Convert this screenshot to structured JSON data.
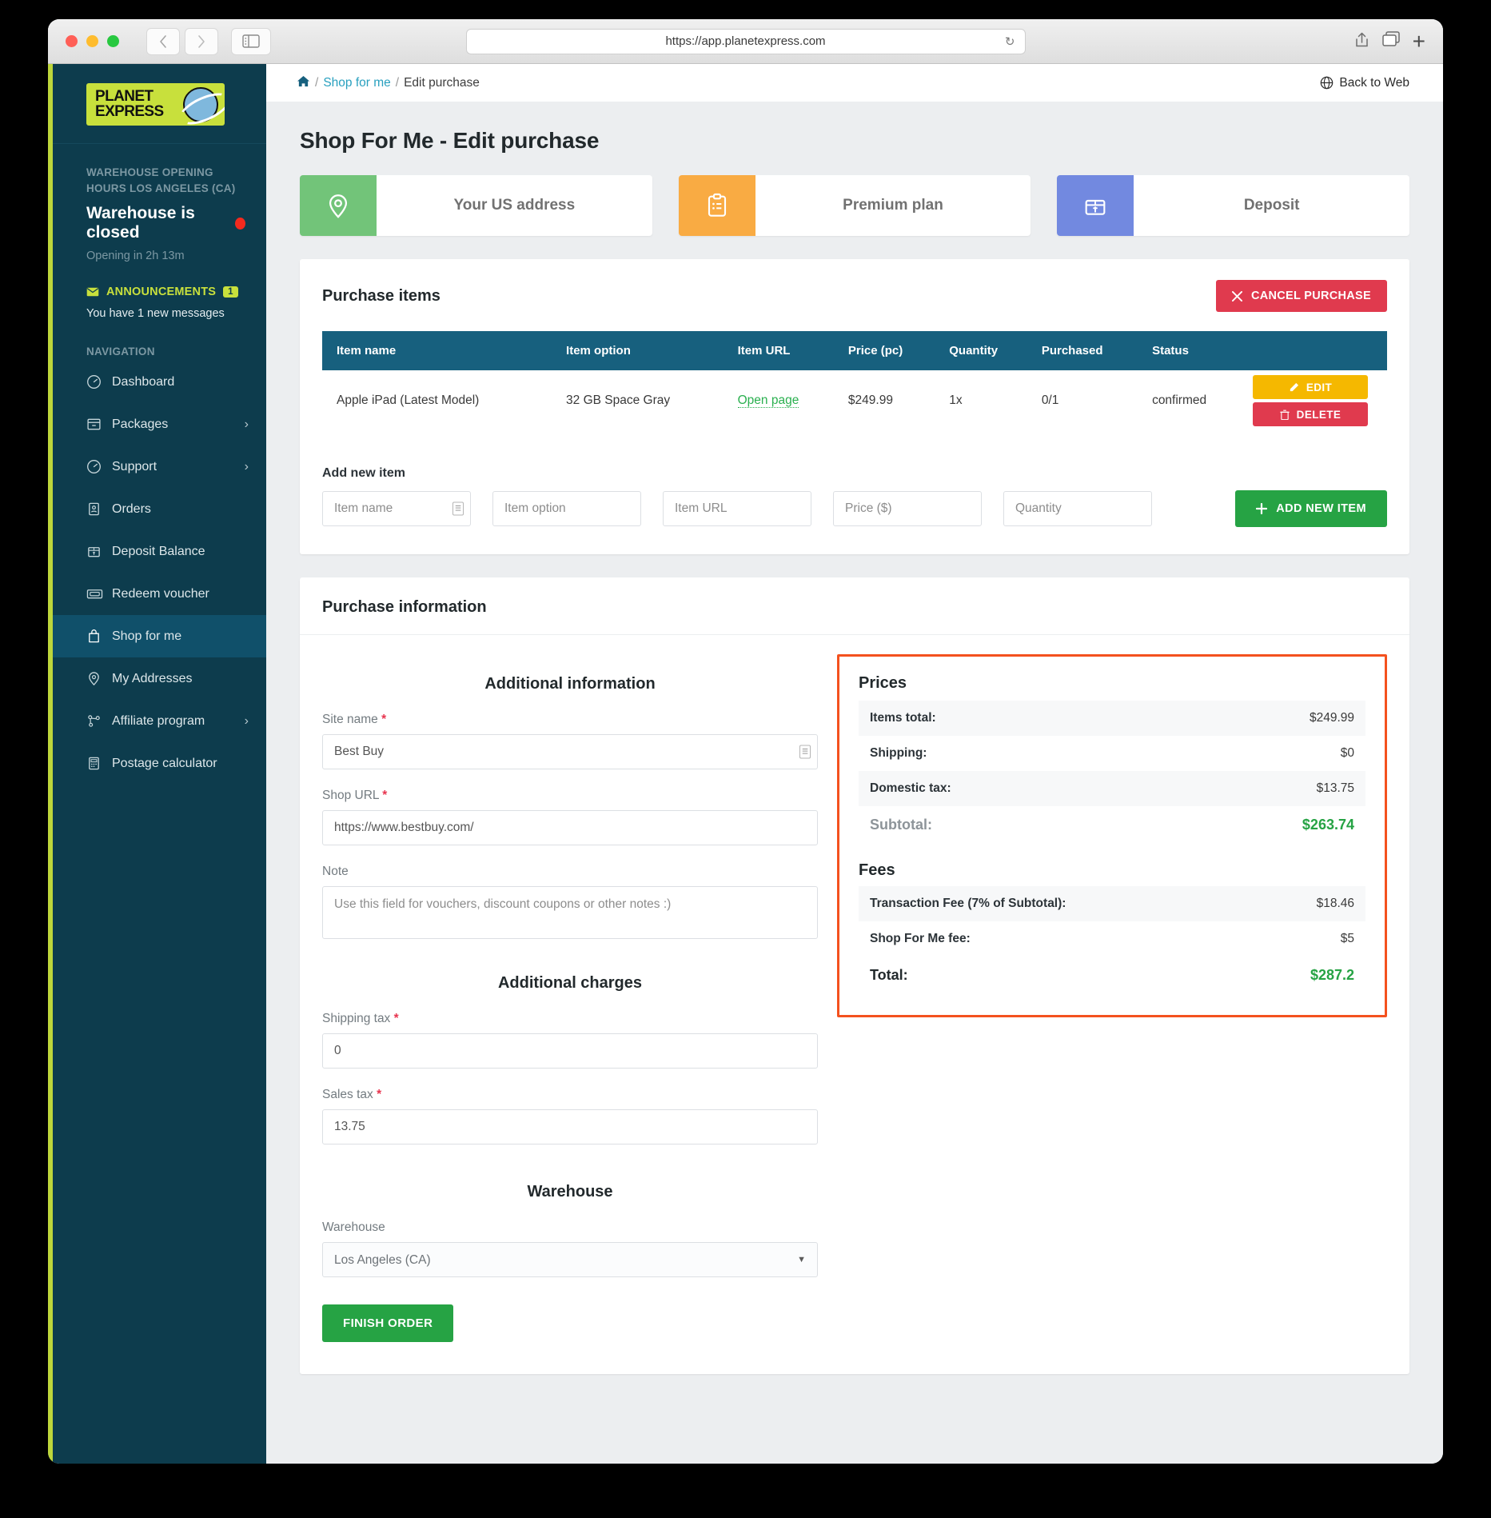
{
  "browser": {
    "url": "https://app.planetexpress.com",
    "back_icon": "chevron-left-icon",
    "forward_icon": "chevron-right-icon",
    "sidebar_icon": "sidebar-toggle-icon",
    "reload_icon": "reload-icon",
    "share_icon": "share-icon",
    "tabs_icon": "new-tab-icon",
    "plus_label": "+"
  },
  "sidebar": {
    "logo_line1": "PLANET",
    "logo_line2": "EXPRESS",
    "warehouse_heading": "WAREHOUSE OPENING HOURS LOS ANGELES (CA)",
    "warehouse_status": "Warehouse is closed",
    "warehouse_opening": "Opening in 2h 13m",
    "announcements_label": "ANNOUNCEMENTS",
    "announcements_count": "1",
    "messages_text": "You have 1 new messages",
    "nav_title": "NAVIGATION",
    "items": [
      {
        "label": "Dashboard",
        "icon": "dashboard-gauge-icon",
        "chevron": false,
        "active": false
      },
      {
        "label": "Packages",
        "icon": "package-box-icon",
        "chevron": true,
        "active": false
      },
      {
        "label": "Support",
        "icon": "support-gauge-icon",
        "chevron": true,
        "active": false
      },
      {
        "label": "Orders",
        "icon": "orders-id-icon",
        "chevron": false,
        "active": false
      },
      {
        "label": "Deposit Balance",
        "icon": "deposit-box-icon",
        "chevron": false,
        "active": false
      },
      {
        "label": "Redeem voucher",
        "icon": "voucher-ticket-icon",
        "chevron": false,
        "active": false
      },
      {
        "label": "Shop for me",
        "icon": "shopping-bag-icon",
        "chevron": false,
        "active": true
      },
      {
        "label": "My Addresses",
        "icon": "map-pin-icon",
        "chevron": false,
        "active": false
      },
      {
        "label": "Affiliate program",
        "icon": "affiliate-network-icon",
        "chevron": true,
        "active": false
      },
      {
        "label": "Postage calculator",
        "icon": "calculator-icon",
        "chevron": false,
        "active": false
      }
    ]
  },
  "breadcrumb": {
    "home_icon": "home-icon",
    "link": "Shop for me",
    "current": "Edit purchase",
    "sep": "/"
  },
  "back_to_web": {
    "label": "Back to Web",
    "icon": "globe-icon"
  },
  "page_title": "Shop For Me - Edit purchase",
  "tabs": [
    {
      "label": "Your US address",
      "icon": "map-pin-icon",
      "color": "#72c479"
    },
    {
      "label": "Premium plan",
      "icon": "clipboard-list-icon",
      "color": "#f9ab43"
    },
    {
      "label": "Deposit",
      "icon": "deposit-box-icon",
      "color": "#7289e0"
    }
  ],
  "purchase_items": {
    "title": "Purchase items",
    "cancel_label": "CANCEL PURCHASE",
    "cancel_icon": "close-x-icon",
    "columns": [
      "Item name",
      "Item option",
      "Item URL",
      "Price (pc)",
      "Quantity",
      "Purchased",
      "Status"
    ],
    "rows": [
      {
        "name": "Apple iPad (Latest Model)",
        "option": "32 GB Space Gray",
        "url_label": "Open page",
        "price": "$249.99",
        "quantity": "1x",
        "purchased": "0/1",
        "status": "confirmed",
        "edit_label": "EDIT",
        "edit_icon": "pencil-icon",
        "delete_label": "DELETE",
        "delete_icon": "trash-icon"
      }
    ],
    "add_new_label": "Add new item",
    "add_fields": [
      {
        "placeholder": "Item name",
        "name": "item-name-input",
        "badge": true
      },
      {
        "placeholder": "Item option",
        "name": "item-option-input",
        "badge": false
      },
      {
        "placeholder": "Item URL",
        "name": "item-url-input",
        "badge": false
      },
      {
        "placeholder": "Price ($)",
        "name": "item-price-input",
        "badge": false
      },
      {
        "placeholder": "Quantity",
        "name": "item-quantity-input",
        "badge": false
      }
    ],
    "add_button_label": "ADD NEW ITEM",
    "add_button_icon": "plus-icon"
  },
  "purchase_information": {
    "title": "Purchase information",
    "additional_information_title": "Additional information",
    "site_name_label": "Site name",
    "site_name_value": "Best Buy",
    "shop_url_label": "Shop URL",
    "shop_url_value": "https://www.bestbuy.com/",
    "note_label": "Note",
    "note_placeholder": "Use this field for vouchers, discount coupons or other notes :)",
    "additional_charges_title": "Additional charges",
    "shipping_tax_label": "Shipping tax",
    "shipping_tax_value": "0",
    "sales_tax_label": "Sales tax",
    "sales_tax_value": "13.75",
    "warehouse_title": "Warehouse",
    "warehouse_label": "Warehouse",
    "warehouse_value": "Los Angeles (CA)",
    "finish_label": "FINISH ORDER",
    "required_mark": "*"
  },
  "prices": {
    "heading": "Prices",
    "rows": [
      {
        "label": "Items total:",
        "value": "$249.99"
      },
      {
        "label": "Shipping:",
        "value": "$0"
      },
      {
        "label": "Domestic tax:",
        "value": "$13.75"
      }
    ],
    "subtotal_label": "Subtotal:",
    "subtotal_value": "$263.74",
    "fees_heading": "Fees",
    "fee_rows": [
      {
        "label": "Transaction Fee (7% of Subtotal):",
        "value": "$18.46"
      },
      {
        "label": "Shop For Me fee:",
        "value": "$5"
      }
    ],
    "total_label": "Total:",
    "total_value": "$287.2",
    "border_color": "#f4511e",
    "accent_green": "#26a344"
  }
}
